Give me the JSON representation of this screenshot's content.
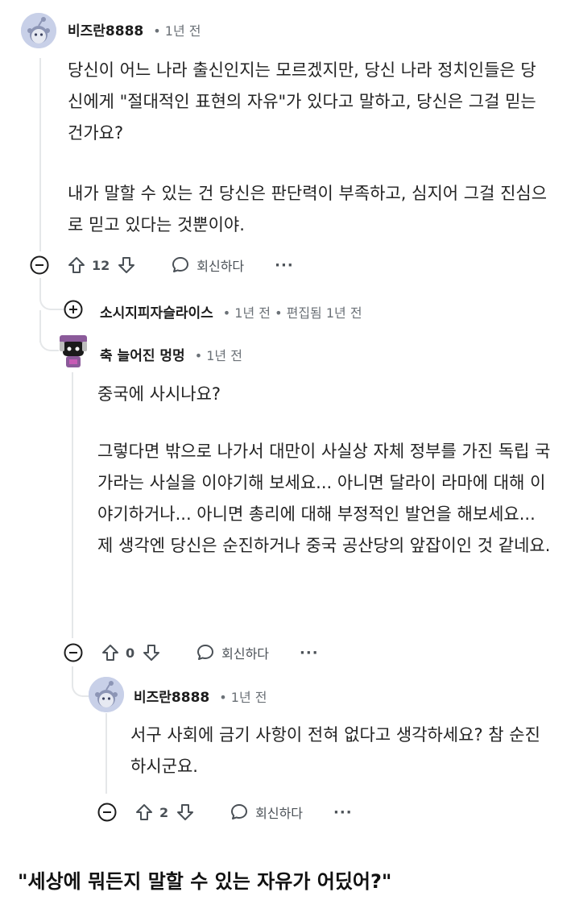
{
  "comments": [
    {
      "author": "비즈란8888",
      "meta": "• 1년 전",
      "paragraphs": [
        "당신이 어느 나라 출신인지는 모르겠지만, 당신 나라 정치인들은 당신에게 \"절대적인 표현의 자유\"가 있다고 말하고, 당신은 그걸 믿는 건가요?",
        "내가 말할 수 있는 건 당신은 판단력이 부족하고, 심지어 그걸 진심으로 믿고 있다는 것뿐이야."
      ],
      "votes": "12",
      "reply_label": "회신하다",
      "more_label": "···"
    },
    {
      "author": "소시지피자슬라이스",
      "meta": "• 1년 전 • 편집됨 1년 전"
    },
    {
      "author": "축 늘어진 멍멍",
      "meta": "• 1년 전",
      "paragraphs": [
        "중국에 사시나요?",
        "그렇다면 밖으로 나가서 대만이 사실상 자체 정부를 가진 독립 국가라는 사실을 이야기해 보세요... 아니면 달라이 라마에 대해 이야기하거나... 아니면 총리에 대해 부정적인 발언을 해보세요... 제 생각엔 당신은 순진하거나 중국 공산당의 앞잡이인 것 같네요."
      ],
      "votes": "0",
      "reply_label": "회신하다",
      "more_label": "···"
    },
    {
      "author": "비즈란8888",
      "meta": "• 1년 전",
      "paragraphs": [
        "서구 사회에 금기 사항이 전혀 없다고 생각하세요? 참 순진하시군요."
      ],
      "votes": "2",
      "reply_label": "회신하다",
      "more_label": "···"
    }
  ],
  "caption": "\"세상에 뭐든지 말할 수 있는 자유가 어딨어?\"",
  "colors": {
    "thread_line": "#e5e7e9",
    "text": "#222222",
    "meta": "#6b7177",
    "avatar_bg": "#c8d0e8",
    "avatar2_bg": "#8b5a9a"
  },
  "icons": [
    "snoo-avatar",
    "collapse-icon",
    "expand-icon",
    "upvote-icon",
    "downvote-icon",
    "reply-bubble-icon",
    "more-icon"
  ]
}
